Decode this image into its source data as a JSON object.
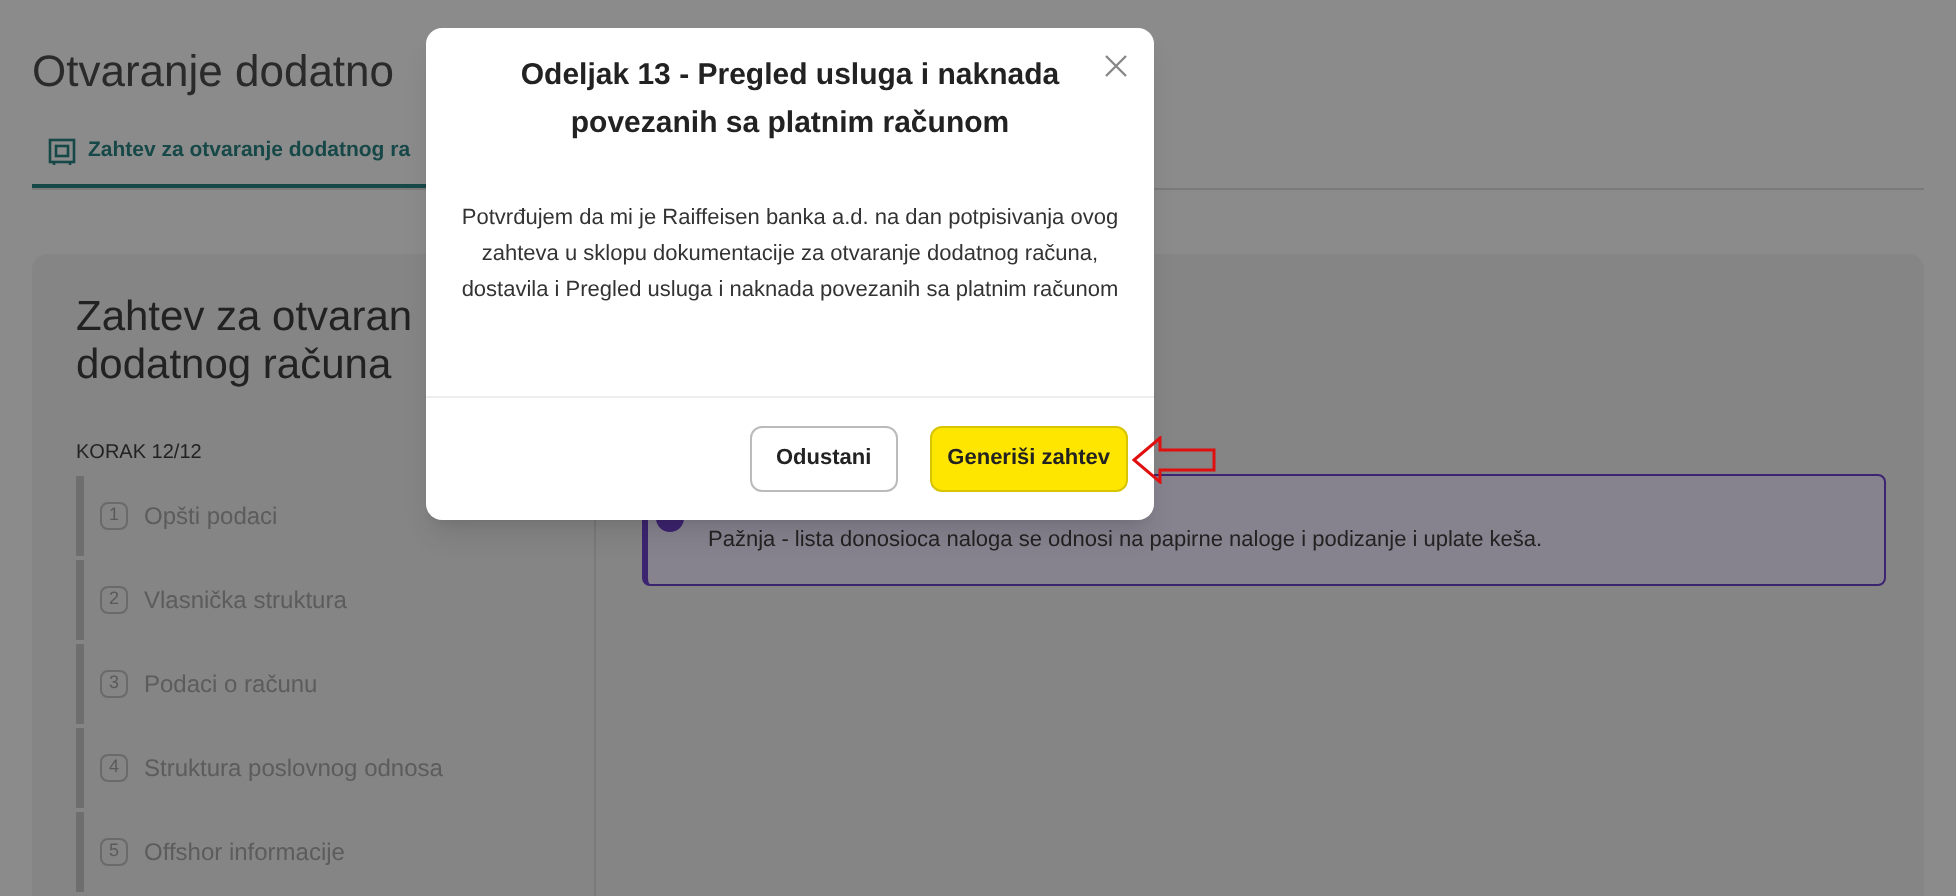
{
  "page": {
    "title": "Otvaranje dodatno"
  },
  "tabs": [
    {
      "label": "Zahtev za otvaranje dodatnog ra",
      "selected": true
    }
  ],
  "wizard": {
    "title_lines": [
      "Zahtev za otvaran",
      "dodatnog računa"
    ],
    "step_counter": "KORAK 12/12",
    "steps": [
      {
        "number": "1",
        "label": "Opšti podaci"
      },
      {
        "number": "2",
        "label": "Vlasnička struktura"
      },
      {
        "number": "3",
        "label": "Podaci o računu"
      },
      {
        "number": "4",
        "label": "Struktura poslovnog odnosa"
      },
      {
        "number": "5",
        "label": "Offshor informacije"
      }
    ]
  },
  "notice": {
    "text": "Pažnja - lista donosioca naloga se odnosi na papirne naloge i podizanje i uplate keša."
  },
  "dialog": {
    "title": "Odeljak 13 - Pregled usluga i naknada povezanih sa platnim računom",
    "body": "Potvrđujem da mi je Raiffeisen banka a.d. na dan potpisivanja ovog zahteva u sklopu dokumentacije za otvaranje dodatnog računa, dostavila i Pregled usluga i naknada povezanih sa platnim računom",
    "buttons": [
      {
        "label": "Odustani",
        "kind": "secondary"
      },
      {
        "label": "Generiši zahtev",
        "kind": "primary"
      }
    ]
  }
}
